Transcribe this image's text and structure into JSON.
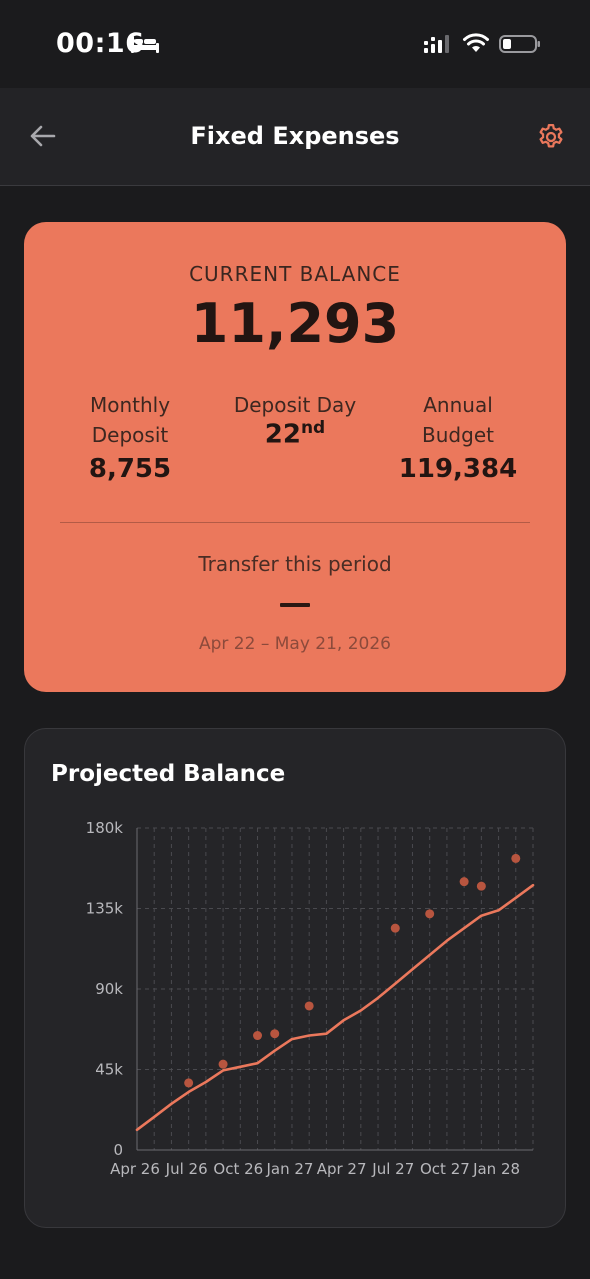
{
  "status_bar": {
    "time": "00:16"
  },
  "header": {
    "title": "Fixed Expenses",
    "back_icon": "arrow-left-icon",
    "settings_icon": "gear-icon",
    "accent_color": "#eb785c"
  },
  "balance_card": {
    "label": "CURRENT BALANCE",
    "value": "11,293",
    "monthly_deposit": {
      "label_line1": "Monthly",
      "label_line2": "Deposit",
      "value": "8,755"
    },
    "deposit_day": {
      "label": "Deposit Day",
      "value": "22",
      "suffix": "nd"
    },
    "annual_budget": {
      "label_line1": "Annual",
      "label_line2": "Budget",
      "value": "119,384"
    },
    "transfer_label": "Transfer this period",
    "transfer_value": "—",
    "period_range": "Apr 22 – May 21, 2026",
    "background_color": "#eb785c"
  },
  "chart_card": {
    "title": "Projected Balance"
  },
  "chart_data": {
    "type": "line",
    "title": "Projected Balance",
    "x_ticks": [
      "Apr 26",
      "Jul 26",
      "Oct 26",
      "Jan 27",
      "Apr 27",
      "Jul 27",
      "Oct 27",
      "Jan 28"
    ],
    "y_ticks": [
      "0",
      "45k",
      "90k",
      "135k",
      "180k"
    ],
    "ylim": [
      0,
      180000
    ],
    "x_unit": "months since Apr 26",
    "xlim": [
      0,
      23
    ],
    "line_color": "#eb785c",
    "point_color": "#b8553f",
    "grid": true,
    "series": [
      {
        "values": [
          [
            0,
            11293
          ],
          [
            1,
            18500
          ],
          [
            2,
            25800
          ],
          [
            3,
            32500
          ],
          [
            4,
            38000
          ],
          [
            5,
            44500
          ],
          [
            6,
            46500
          ],
          [
            7,
            48500
          ],
          [
            8,
            55500
          ],
          [
            9,
            62000
          ],
          [
            10,
            64000
          ],
          [
            11,
            65000
          ],
          [
            12,
            72500
          ],
          [
            13,
            78000
          ],
          [
            14,
            85000
          ],
          [
            15,
            93000
          ],
          [
            16,
            101000
          ],
          [
            17,
            109000
          ],
          [
            18,
            117000
          ],
          [
            19,
            124000
          ],
          [
            20,
            131000
          ],
          [
            21,
            134000
          ],
          [
            22,
            141000
          ],
          [
            23,
            148000
          ]
        ]
      }
    ],
    "markers": [
      [
        3,
        37500
      ],
      [
        5,
        48000
      ],
      [
        7,
        64000
      ],
      [
        8,
        65000
      ],
      [
        10,
        80500
      ],
      [
        15,
        124000
      ],
      [
        17,
        132000
      ],
      [
        19,
        150000
      ],
      [
        20,
        147500
      ],
      [
        22,
        163000
      ]
    ]
  }
}
